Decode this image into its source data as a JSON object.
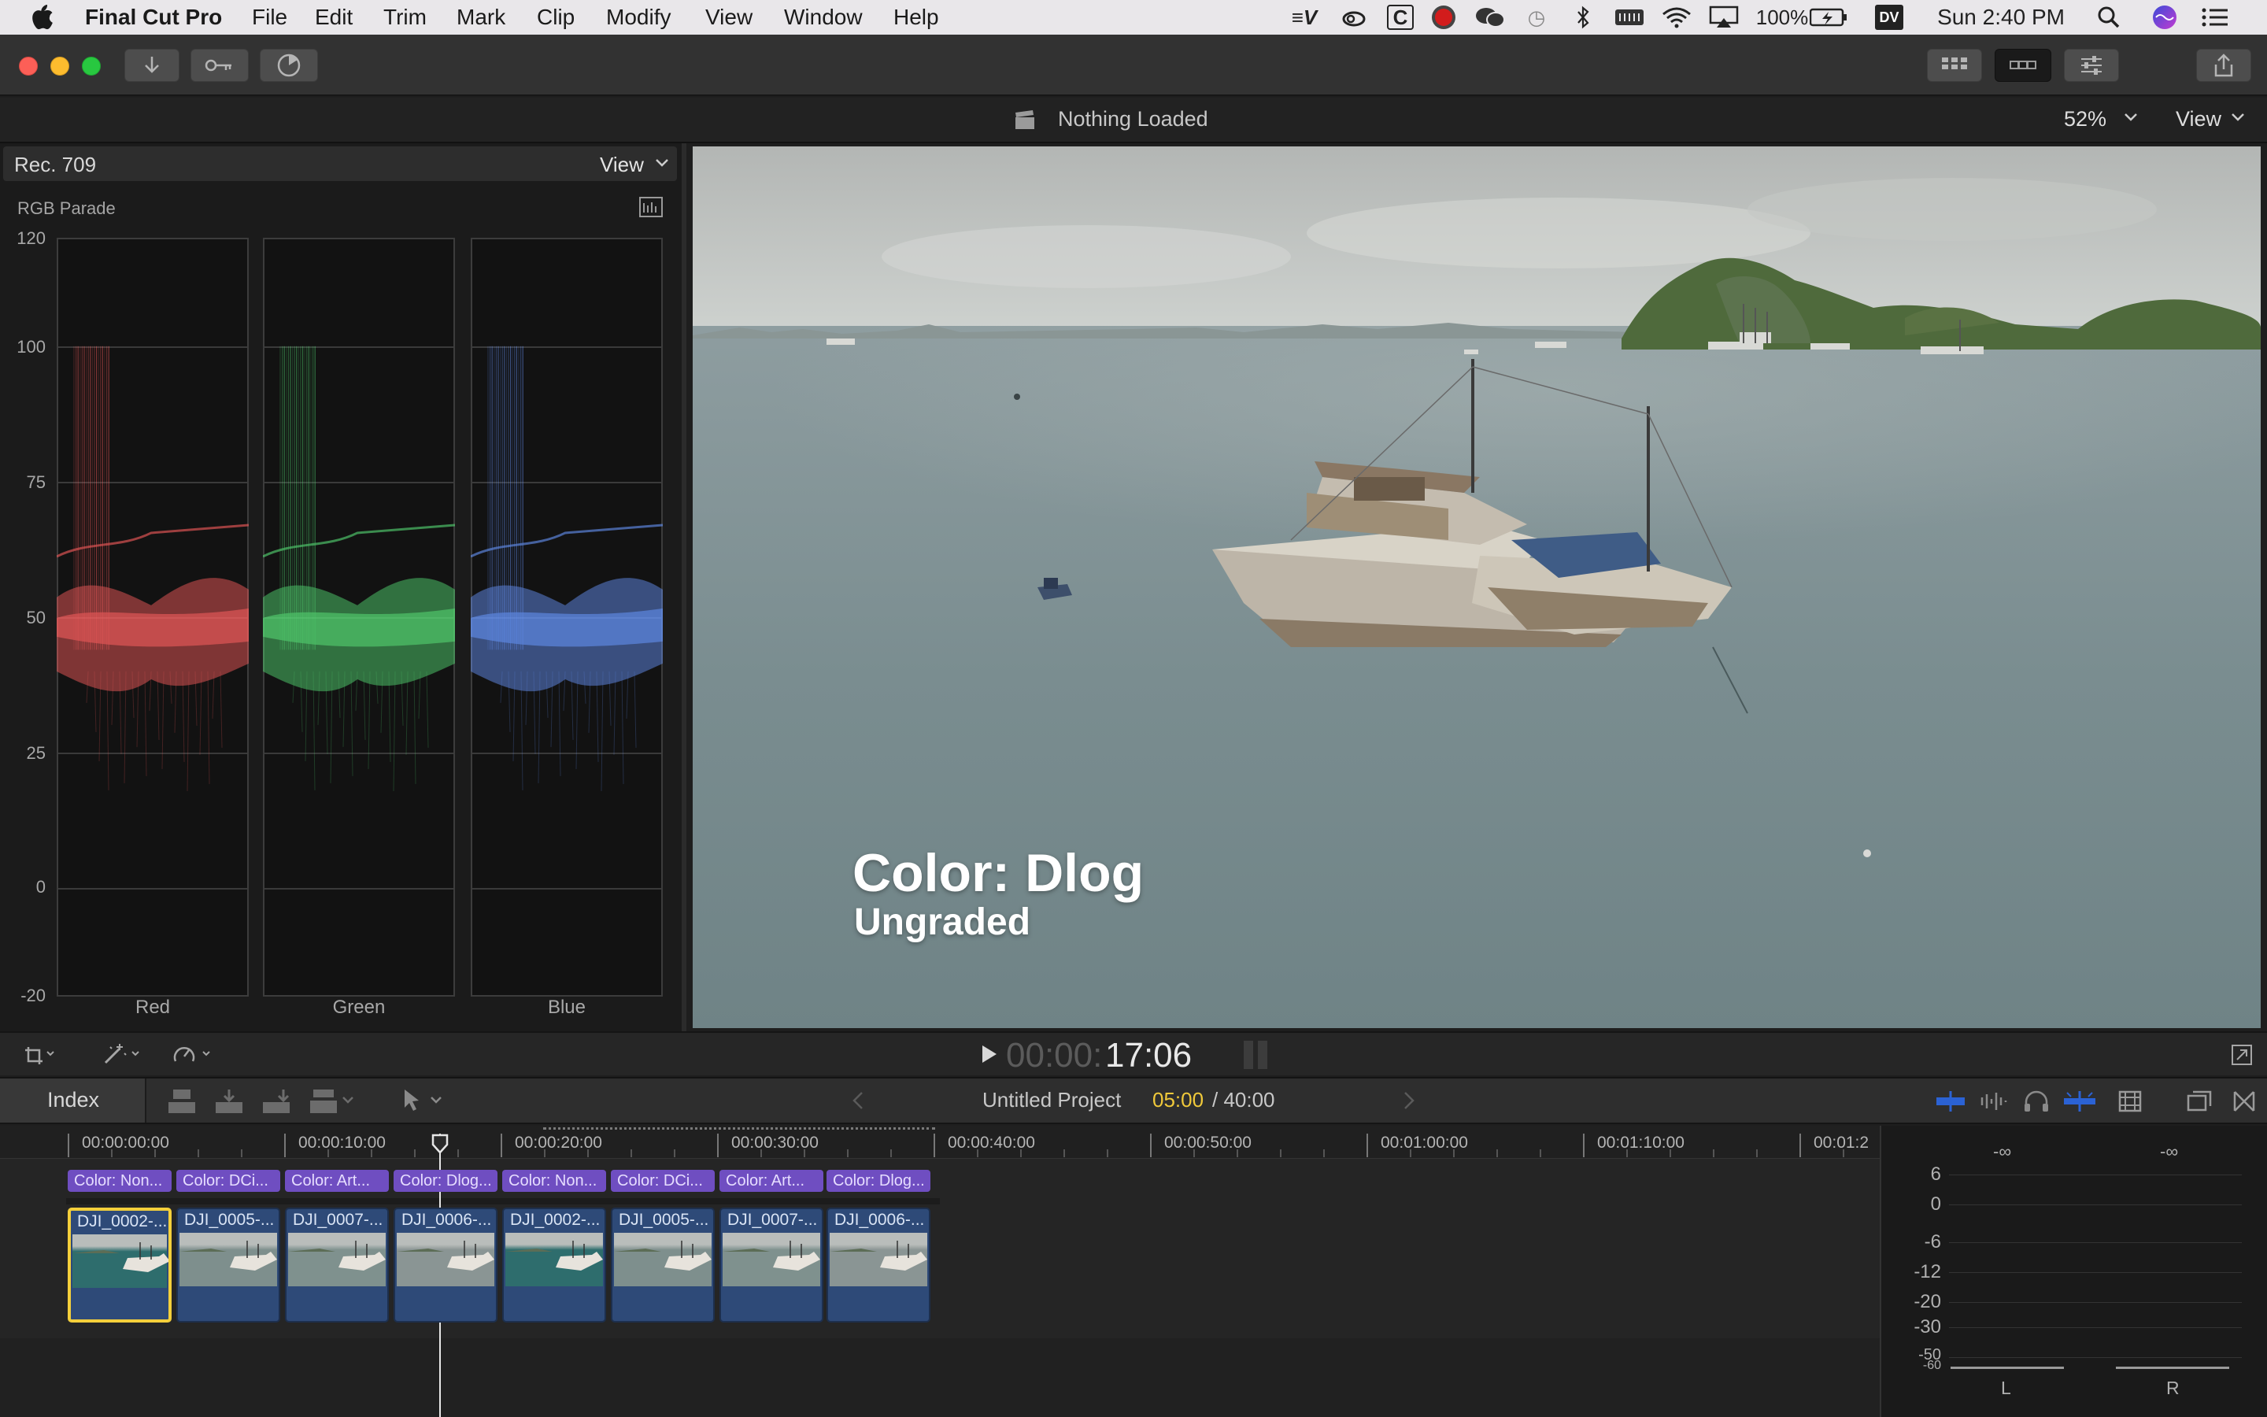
{
  "menubar": {
    "app_name": "Final Cut Pro",
    "items": [
      "File",
      "Edit",
      "Trim",
      "Mark",
      "Clip",
      "Modify",
      "View",
      "Window",
      "Help"
    ],
    "battery": "100%",
    "clock": "Sun 2:40 PM",
    "status_icons": [
      "verbal-icon",
      "creative-cloud-icon",
      "c-app-icon",
      "record-icon",
      "wechat-icon",
      "time-machine-icon",
      "bluetooth-icon",
      "keyboard-icon",
      "wifi-icon",
      "airplay-icon",
      "battery-icon",
      "dv-icon",
      "spotlight-icon",
      "siri-icon",
      "notification-center-icon"
    ],
    "dv_label": "DV",
    "c_label": "C"
  },
  "viewer": {
    "title": "Nothing Loaded",
    "zoom": "52%",
    "view_label": "View",
    "overlay_line1": "Color: Dlog",
    "overlay_line2": "Ungraded"
  },
  "scope": {
    "color_space": "Rec. 709",
    "view_label": "View",
    "type": "RGB Parade",
    "y_labels": [
      "120",
      "100",
      "75",
      "50",
      "25",
      "0",
      "-20"
    ],
    "channels": [
      {
        "name": "Red",
        "color": "#ff6060"
      },
      {
        "name": "Green",
        "color": "#58e078"
      },
      {
        "name": "Blue",
        "color": "#6a98ff"
      }
    ]
  },
  "transport": {
    "timecode_dim": "00:00:",
    "timecode": "17:06"
  },
  "timeline": {
    "index_label": "Index",
    "project_name": "Untitled Project",
    "position": "05:00",
    "duration": "/ 40:00",
    "ruler": [
      "00:00:00:00",
      "00:00:10:00",
      "00:00:20:00",
      "00:00:30:00",
      "00:00:40:00",
      "00:00:50:00",
      "00:01:00:00",
      "00:01:10:00",
      "00:01:2"
    ],
    "tags": [
      "Color: Non...",
      "Color: DCi...",
      "Color: Art...",
      "Color: Dlog...",
      "Color: Non...",
      "Color: DCi...",
      "Color: Art...",
      "Color: Dlog..."
    ],
    "clips": [
      "DJI_0002-...",
      "DJI_0005-...",
      "DJI_0007-...",
      "DJI_0006-...",
      "DJI_0002-...",
      "DJI_0005-...",
      "DJI_0007-...",
      "DJI_0006-..."
    ],
    "playhead_fraction": 0.2
  },
  "audio": {
    "peak_left": "-∞",
    "peak_right": "-∞",
    "scale": [
      "6",
      "0",
      "-6",
      "-12",
      "-20",
      "-30",
      "-50",
      "-60"
    ],
    "channels": [
      "L",
      "R"
    ]
  },
  "colors": {
    "accent_blue": "#2b62d4",
    "tag_purple": "#6f4ec1",
    "clip_blue": "#2e4a78",
    "selection_yellow": "#f4cf3b",
    "timecode_yellow": "#f0c93a"
  }
}
